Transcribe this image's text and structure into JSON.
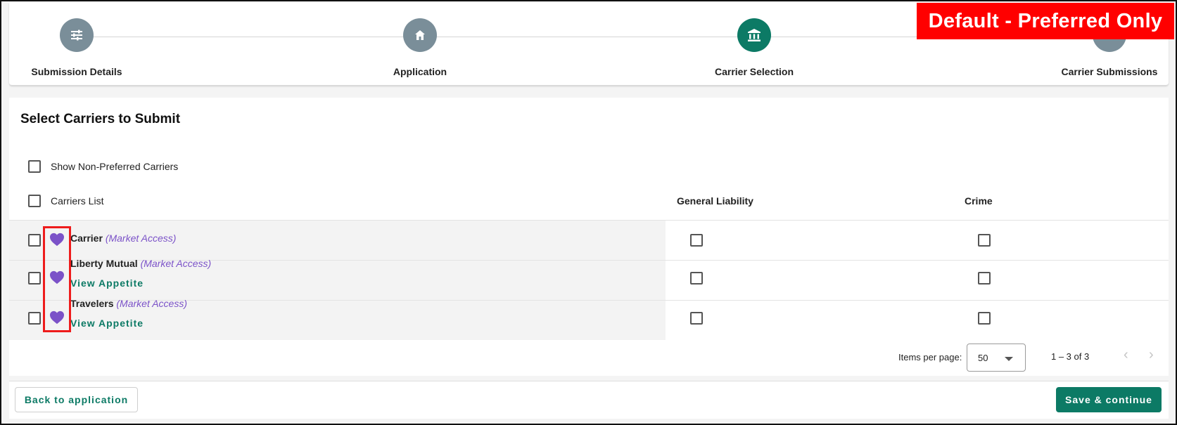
{
  "banner": "Default - Preferred Only",
  "stepper": {
    "steps": [
      {
        "label": "Submission Details",
        "icon": "sliders-icon",
        "active": false
      },
      {
        "label": "Application",
        "icon": "home-icon",
        "active": false
      },
      {
        "label": "Carrier Selection",
        "icon": "bank-icon",
        "active": true
      },
      {
        "label": "Carrier Submissions",
        "icon": "send-icon",
        "active": false
      }
    ]
  },
  "card": {
    "title": "Select Carriers to Submit",
    "show_non_preferred_label": "Show Non-Preferred Carriers",
    "columns": {
      "carriers": "Carriers List",
      "general_liability": "General Liability",
      "crime": "Crime"
    },
    "rows": [
      {
        "name": "Carrier",
        "tag": "(Market Access)",
        "link": ""
      },
      {
        "name": "Liberty Mutual",
        "tag": "(Market Access)",
        "link": "View Appetite"
      },
      {
        "name": "Travelers",
        "tag": "(Market Access)",
        "link": "View Appetite"
      }
    ],
    "pagination": {
      "items_per_page_label": "Items per page:",
      "items_per_page_value": "50",
      "range": "1 – 3 of 3"
    }
  },
  "footer": {
    "back_label": "Back to application",
    "save_label": "Save & continue"
  },
  "colors": {
    "accent": "#0c7a65",
    "step_inactive": "#7a8e99",
    "heart": "#7b52c8",
    "banner": "#ff0000"
  }
}
